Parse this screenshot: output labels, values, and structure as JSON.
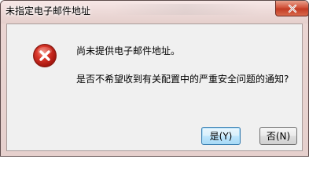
{
  "window": {
    "title": "未指定电子邮件地址"
  },
  "dialog": {
    "message_primary": "尚未提供电子邮件地址。",
    "message_secondary": "是否不希望收到有关配置中的严重安全问题的通知?",
    "icon": "error-icon"
  },
  "buttons": {
    "yes_label": "是(Y)",
    "no_label": "否(N)"
  },
  "colors": {
    "close_button": "#c23b24",
    "error_icon": "#d42a1c",
    "default_button_border": "#3c7fb1"
  }
}
